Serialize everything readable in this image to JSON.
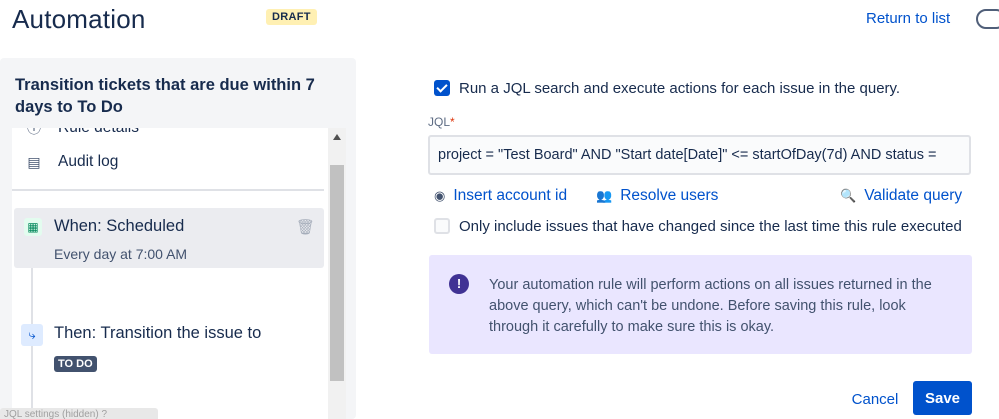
{
  "header": {
    "title": "Automation",
    "badge": "DRAFT",
    "return_link": "Return to list"
  },
  "rule": {
    "title": "Transition tickets that are due within 7 days to To Do"
  },
  "steps": {
    "rule_details": "Rule details",
    "audit_log": "Audit log",
    "when_title": "When: Scheduled",
    "when_subtitle": "Every day at 7:00 AM",
    "then_title": "Then: Transition the issue to",
    "then_badge": "TO DO"
  },
  "tooltip_ghost": "JQL settings (hidden) ?",
  "form": {
    "run_jql_label": "Run a JQL search and execute actions for each issue in the query.",
    "run_jql_checked": true,
    "jql_label": "JQL",
    "jql_required_mark": "*",
    "jql_value": "project = \"Test Board\" AND \"Start date[Date]\" <= startOfDay(7d) AND status = ",
    "insert_account_id": "Insert account id",
    "resolve_users": "Resolve users",
    "validate_query": "Validate query",
    "only_changed_label": "Only include issues that have changed since the last time this rule executed",
    "only_changed_checked": false,
    "warning_text": "Your automation rule will perform actions on all issues returned in the above query, which can't be undone. Before saving this rule, look through it carefully to make sure this is okay."
  },
  "footer": {
    "cancel": "Cancel",
    "save": "Save"
  },
  "colors": {
    "brand": "#0052cc",
    "draft_badge": "#fff0b3",
    "warning_bg": "#eae6ff",
    "todo_badge": "#42526e"
  },
  "icons": {
    "rule_details": "info-circle-icon",
    "audit_log": "document-icon",
    "when": "calendar-icon",
    "then": "transition-icon",
    "delete": "trash-icon",
    "insert_account": "person-circle-icon",
    "resolve_users": "people-icon",
    "validate": "search-icon",
    "warning": "exclamation-icon"
  }
}
